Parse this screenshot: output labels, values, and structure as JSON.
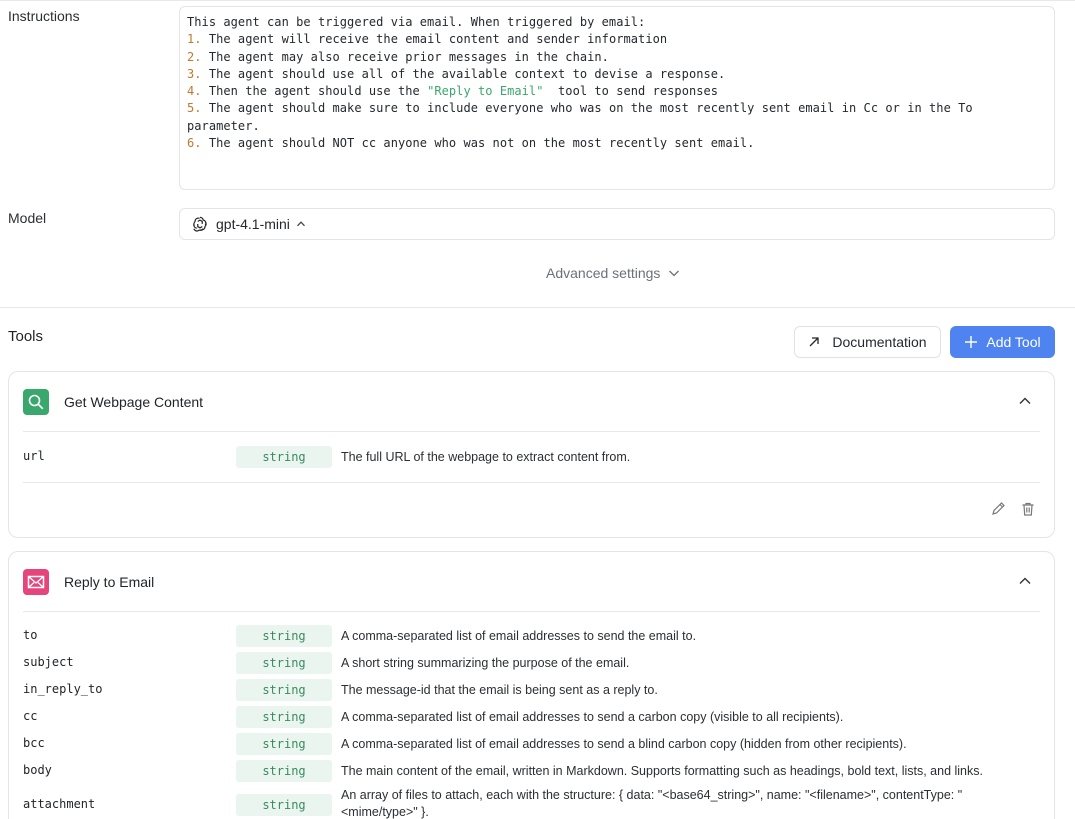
{
  "instructions": {
    "label": "Instructions",
    "intro": "This agent can be triggered via email. When triggered by email:",
    "items": [
      {
        "num": "1.",
        "text": " The agent will receive the email content and sender information"
      },
      {
        "num": "2.",
        "text": " The agent may also receive prior messages in the chain."
      },
      {
        "num": "3.",
        "text": " The agent should use all of the available context to devise a response."
      },
      {
        "num": "5.",
        "text": " The agent should make sure to include everyone who was on the most recently sent email in Cc or in the To\nparameter."
      },
      {
        "num": "6.",
        "text": " The agent should NOT cc anyone who was not on the most recently sent email."
      }
    ],
    "item4": {
      "num": "4.",
      "pre": " Then the agent should use the ",
      "str": "\"Reply to Email\"",
      "post": "  tool to send responses"
    }
  },
  "model": {
    "label": "Model",
    "value": "gpt-4.1-mini"
  },
  "advanced_settings": "Advanced settings",
  "tools": {
    "title": "Tools",
    "documentation_label": "Documentation",
    "add_tool_label": "Add Tool",
    "cards": [
      {
        "name": "Get Webpage Content",
        "icon": "search-icon",
        "color": "#3aa76d",
        "params": [
          {
            "name": "url",
            "type": "string",
            "desc": "The full URL of the webpage to extract content from."
          }
        ]
      },
      {
        "name": "Reply to Email",
        "icon": "mail-icon",
        "color": "#e5457a",
        "params": [
          {
            "name": "to",
            "type": "string",
            "desc": "A comma-separated list of email addresses to send the email to."
          },
          {
            "name": "subject",
            "type": "string",
            "desc": "A short string summarizing the purpose of the email."
          },
          {
            "name": "in_reply_to",
            "type": "string",
            "desc": "The message-id that the email is being sent as a reply to."
          },
          {
            "name": "cc",
            "type": "string",
            "desc": "A comma-separated list of email addresses to send a carbon copy (visible to all recipients)."
          },
          {
            "name": "bcc",
            "type": "string",
            "desc": "A comma-separated list of email addresses to send a blind carbon copy (hidden from other recipients)."
          },
          {
            "name": "body",
            "type": "string",
            "desc": "The main content of the email, written in Markdown. Supports formatting such as headings, bold text, lists, and links."
          },
          {
            "name": "attachment",
            "type": "string",
            "desc": "An array of files to attach, each with the structure: { data: \"<base64_string>\", name: \"<filename>\", contentType: \"<mime/type>\" }."
          }
        ]
      }
    ]
  }
}
